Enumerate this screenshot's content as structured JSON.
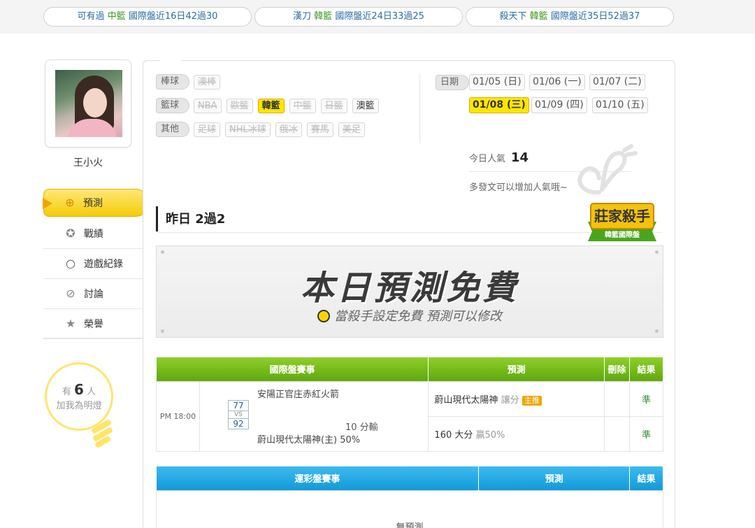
{
  "ticker": [
    {
      "name": "可有過",
      "team": "中籃",
      "rec": "國際盤近16日42過30"
    },
    {
      "name": "漢刀",
      "team": "韓籃",
      "rec": "國際盤近24日33過25"
    },
    {
      "name": "殺天下",
      "team": "韓籃",
      "rec": "國際盤近35日52過37"
    }
  ],
  "profile": {
    "username": "王小火"
  },
  "nav": [
    {
      "label": "預測",
      "icon": "target-icon",
      "glyph": "⊕"
    },
    {
      "label": "戰績",
      "icon": "medal-icon",
      "glyph": "✪"
    },
    {
      "label": "遊戲紀錄",
      "icon": "ring-icon",
      "glyph": "○"
    },
    {
      "label": "討論",
      "icon": "chat-icon",
      "glyph": "⊘"
    },
    {
      "label": "榮譽",
      "icon": "star-award-icon",
      "glyph": "★"
    }
  ],
  "bulb": {
    "prefix": "有",
    "count": "6",
    "suffix": "人",
    "line2": "加我為明燈"
  },
  "filters": {
    "baseball": {
      "label": "棒球",
      "chips": [
        "澳棒"
      ]
    },
    "basketball": {
      "label": "籃球",
      "chips": [
        "NBA",
        "歐籃",
        "韓籃",
        "中籃",
        "日籃",
        "澳籃"
      ]
    },
    "other": {
      "label": "其他",
      "chips": [
        "足球",
        "NHL冰球",
        "俄冰",
        "賽馬",
        "美足"
      ]
    }
  },
  "dates": {
    "label": "日期",
    "items": [
      "01/05 (日)",
      "01/06 (一)",
      "01/07 (二)",
      "01/08 (三)",
      "01/09 (四)",
      "01/10 (五)"
    ],
    "selected": "01/08 (三)"
  },
  "popularity": {
    "label": "今日人氣",
    "value": "14",
    "hint": "多發文可以增加人氣哦~"
  },
  "yesterday": {
    "text": "昨日 2過2"
  },
  "badge": {
    "line1": "莊家殺手",
    "line2": "韓籃國際盤"
  },
  "banner": {
    "title": "本日預測免費",
    "subtitle": "當殺手設定免費 預測可以修改"
  },
  "intl_table": {
    "headers": {
      "match": "國際盤賽事",
      "pred": "預測",
      "del": "刪除",
      "result": "結果"
    },
    "row": {
      "time": "PM 18:00",
      "score_home": "77",
      "vs": "VS",
      "score_away": "92",
      "team1": "安陽正官庄赤紅火箭",
      "line": "10 分輸",
      "team2": "蔚山現代太陽神(主) 50%",
      "pred1_team": "蔚山現代太陽神",
      "pred1_type": "讓分",
      "pred1_tag": "主推",
      "pred1_result": "準",
      "pred2_main": "160 大分",
      "pred2_sub": "贏50%",
      "pred2_result": "準"
    }
  },
  "lottery_table": {
    "headers": {
      "match": "運彩盤賽事",
      "pred": "預測",
      "result": "結果"
    },
    "empty": "無預測"
  }
}
